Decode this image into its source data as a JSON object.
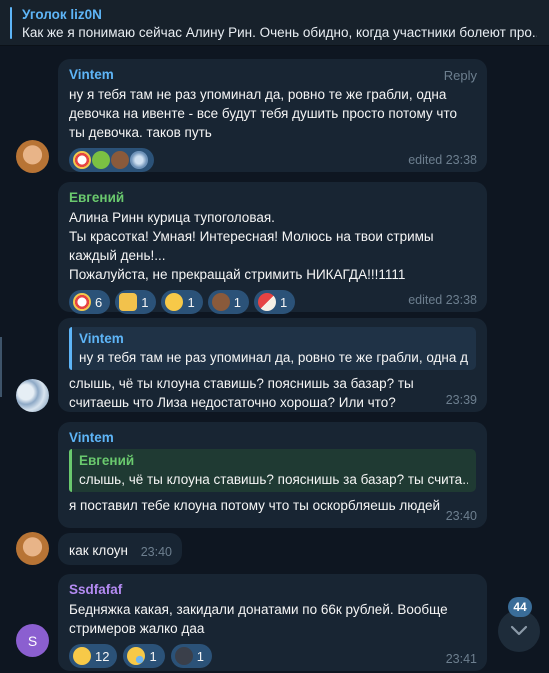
{
  "pinned": {
    "title": "Уголок liz0N",
    "text": "Как же я понимаю сейчас Алину Рин. Очень обидно, когда участники болеют про..."
  },
  "colors": {
    "background": "#0e1621",
    "bubble": "#182533",
    "accent_blue": "#5eb5f7",
    "author_green": "#6ac96e",
    "author_purple": "#b48bf2",
    "reaction_bg": "#2b5278"
  },
  "messages": [
    {
      "author": "Vintem",
      "reply_label": "Reply",
      "text": "ну я тебя там не раз упоминал да, ровно те же грабли, одна девочка на ивенте - все будут тебя душить просто потому что ты девочка. таков путь",
      "time": "edited 23:38",
      "reactions": [
        {
          "icon": "clown-face-icon"
        },
        {
          "icon": "nauseated-face-icon"
        },
        {
          "icon": "monkey-face-icon"
        },
        {
          "icon": "globe-icon"
        }
      ]
    },
    {
      "author": "Евгений",
      "text": "Алина Ринн курица тупоголовая.\nТы красотка! Умная! Интересная! Молюсь на твои стримы каждый день!...\nПожалуйста, не прекращай стримить НИКАГДА!!!1111",
      "time": "edited 23:38",
      "reactions": [
        {
          "icon": "clown-face-icon",
          "count": "6"
        },
        {
          "icon": "thumbs-up-icon",
          "count": "1"
        },
        {
          "icon": "grinning-face-icon",
          "count": "1"
        },
        {
          "icon": "pile-of-poo-icon",
          "count": "1"
        },
        {
          "icon": "pill-icon",
          "count": "1"
        }
      ]
    },
    {
      "quote_author": "Vintem",
      "quote_text": "ну я тебя там не раз упоминал да, ровно те же грабли, одна д...",
      "text": "слышь, чё ты клоуна ставишь? пояснишь за базар? ты считаешь что Лиза недостаточно хороша? Или что?",
      "time": "23:39"
    },
    {
      "author": "Vintem",
      "quote_author": "Евгений",
      "quote_text": "слышь, чё ты клоуна ставишь? пояснишь за базар? ты счита...",
      "text": "я поставил тебе клоуна потому что ты оскорбляешь людей",
      "time": "23:40"
    },
    {
      "text": "как клоун",
      "time": "23:40"
    },
    {
      "author": "Ssdfafaf",
      "avatar_letter": "S",
      "text": "Бедняжка какая, закидали донатами по 66к рублей. Вообще стримеров жалко даа",
      "time": "23:41",
      "reactions": [
        {
          "icon": "grinning-face-icon",
          "count": "12"
        },
        {
          "icon": "crying-face-icon",
          "count": "1"
        },
        {
          "icon": "dark-face-icon",
          "count": "1"
        }
      ]
    }
  ],
  "unread_badge": "44"
}
